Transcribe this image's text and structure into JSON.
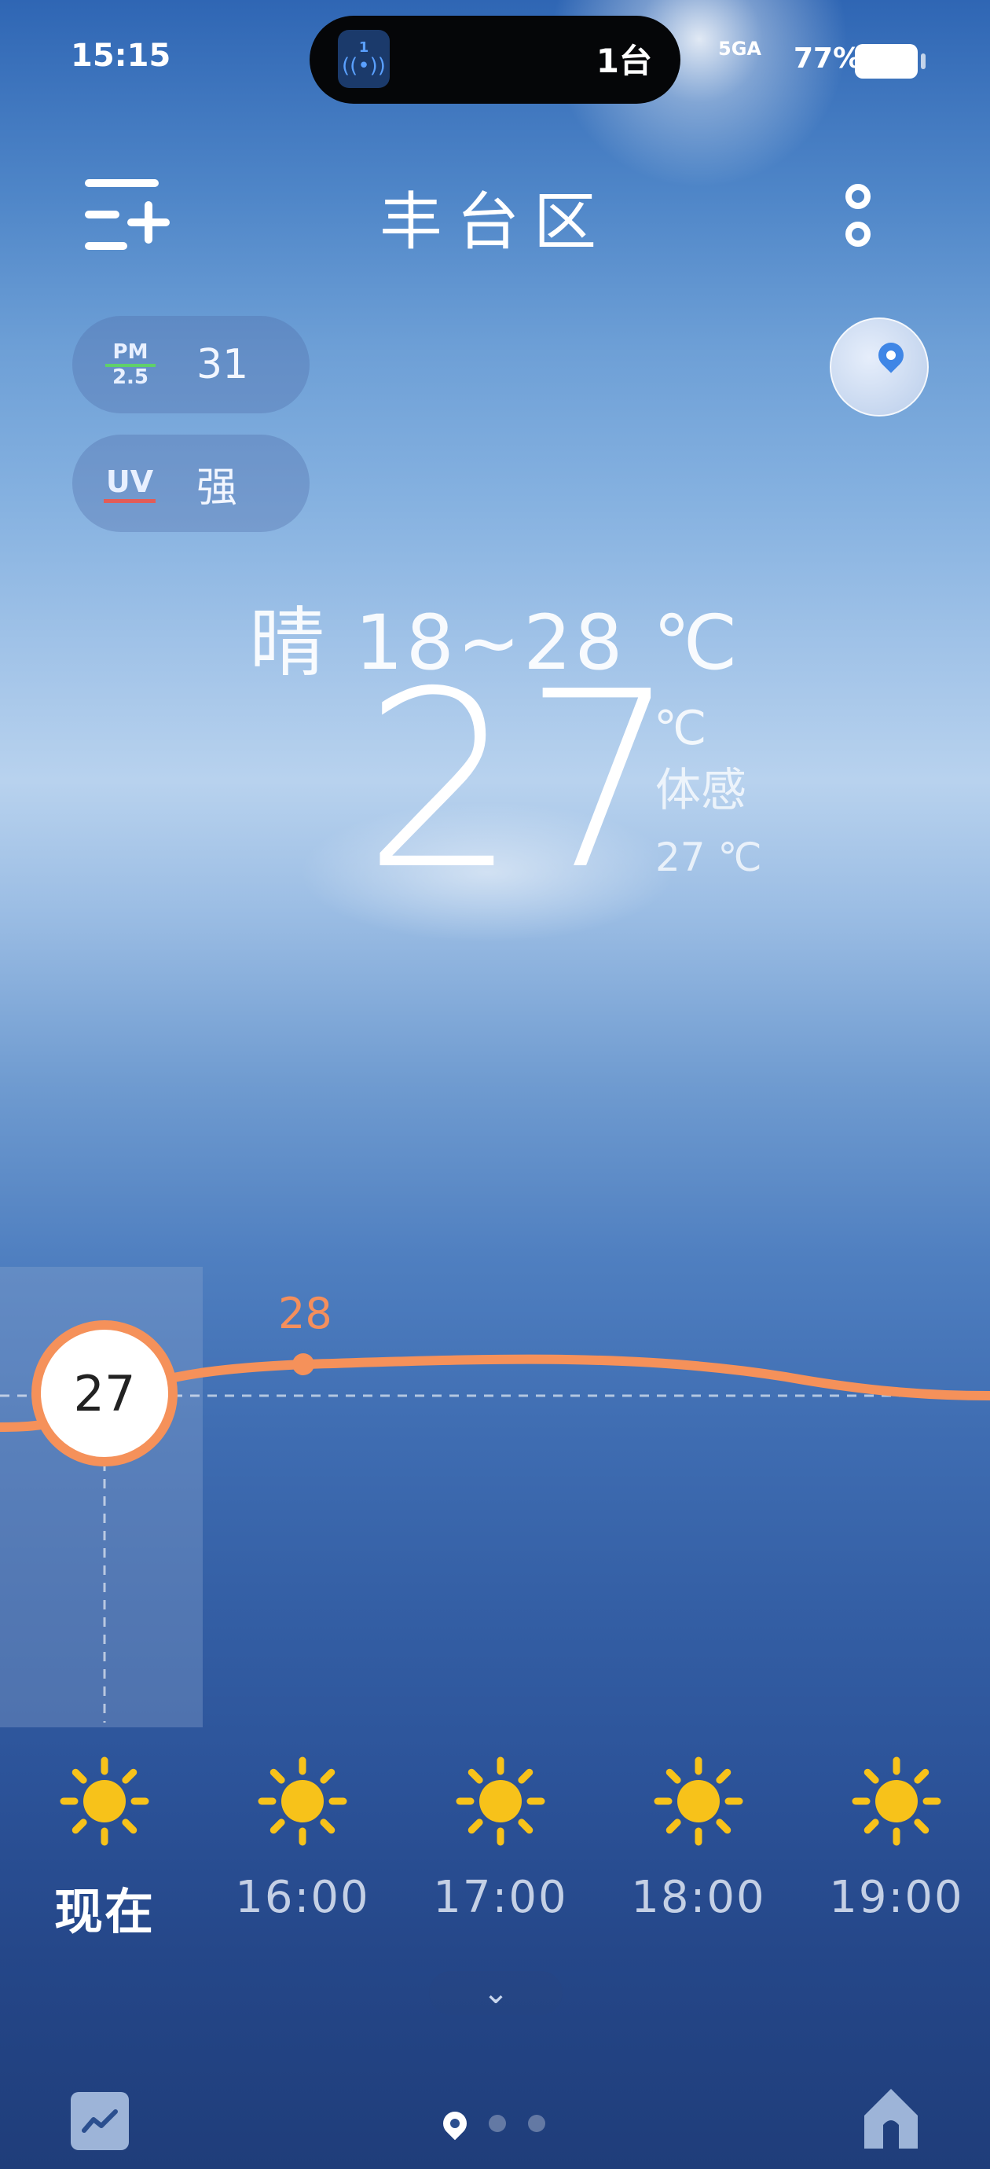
{
  "status_bar": {
    "time": "15:15",
    "island_badge": "1",
    "island_text": "1台",
    "network": "5GA",
    "battery_percent": "77%"
  },
  "header": {
    "city": "丰台区"
  },
  "air": {
    "pm_label_top": "PM",
    "pm_label_bottom": "2.5",
    "pm_value": "31",
    "uv_label": "UV",
    "uv_value": "强"
  },
  "current": {
    "condition_range": "晴  18~28 ℃",
    "temperature": "27",
    "unit": "℃",
    "feels_like_label": "体感",
    "feels_like_value": "27 ℃"
  },
  "chart": {
    "now_value": "27",
    "peak_value": "28",
    "series": [
      27,
      28,
      28,
      28,
      27.5
    ]
  },
  "hourly": [
    {
      "label": "现在",
      "icon": "sun-icon"
    },
    {
      "label": "16:00",
      "icon": "sun-icon"
    },
    {
      "label": "17:00",
      "icon": "sun-icon"
    },
    {
      "label": "18:00",
      "icon": "sun-icon"
    },
    {
      "label": "19:00",
      "icon": "sun-icon"
    }
  ],
  "colors": {
    "accent_orange": "#f5915a",
    "sun_yellow": "#f7c21a"
  }
}
